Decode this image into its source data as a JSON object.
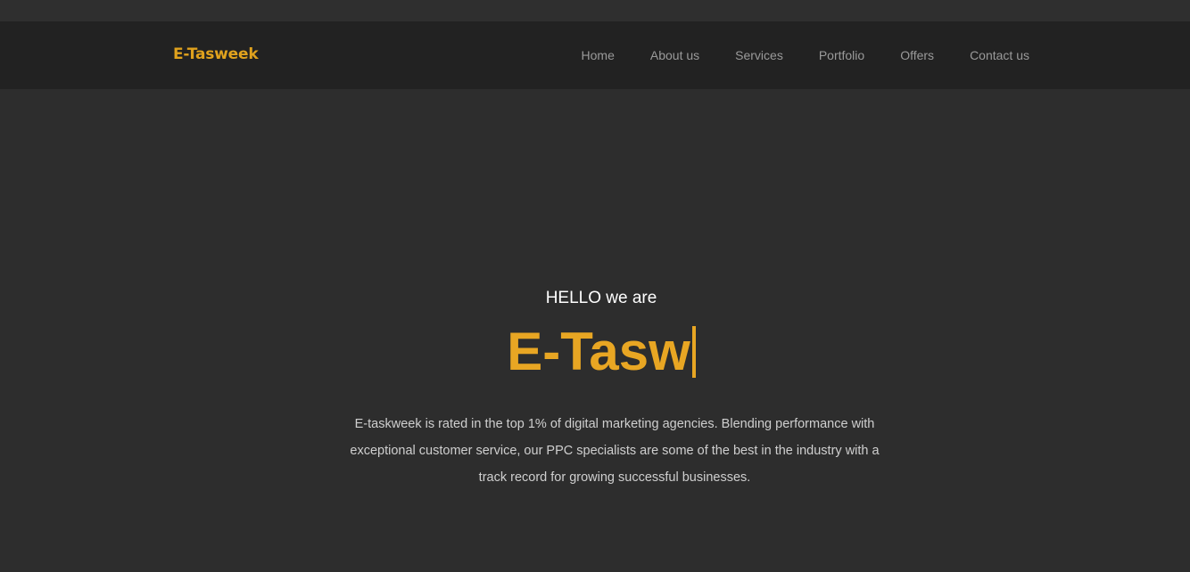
{
  "brand": {
    "name": "E-Tasweek"
  },
  "nav": {
    "items": [
      {
        "label": "Home"
      },
      {
        "label": "About us"
      },
      {
        "label": "Services"
      },
      {
        "label": "Portfolio"
      },
      {
        "label": "Offers"
      },
      {
        "label": "Contact us"
      }
    ]
  },
  "hero": {
    "greeting": "HELLO we are",
    "headline_typed": "E-Tasw",
    "description": "E-taskweek is rated in the top 1% of digital marketing agencies. Blending performance with exceptional customer service, our PPC specialists are some of the best in the industry with a track record for growing successful businesses."
  },
  "colors": {
    "accent": "#e8a623",
    "navbar_bg": "#222222",
    "page_bg": "#2d2d2d",
    "nav_text": "#9a9a9a"
  }
}
